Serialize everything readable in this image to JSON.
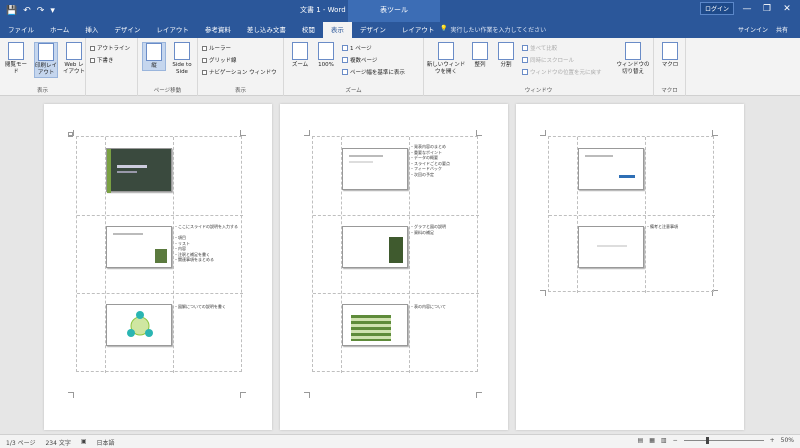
{
  "title_bar": {
    "qat": [
      "💾",
      "↶",
      "↷",
      "▾"
    ],
    "doc_title": "文書 1 - Word",
    "context_group": "表ツール",
    "ribbon_option": "ログイン",
    "controls": [
      "—",
      "❐",
      "✕"
    ]
  },
  "tabs": {
    "items": [
      "ファイル",
      "ホーム",
      "挿入",
      "デザイン",
      "レイアウト",
      "参考資料",
      "差し込み文書",
      "校閲",
      "表示",
      "デザイン",
      "レイアウト"
    ],
    "active_index": 8,
    "tellme": "実行したい作業を入力してください",
    "user_actions": [
      "サインイン",
      "共有"
    ]
  },
  "ribbon": {
    "views": {
      "read_mode": "閲覧モード",
      "print_layout": "印刷レイアウト",
      "web_layout": "Web レイアウト",
      "outline": "アウトライン",
      "draft": "下書き",
      "label": "表示"
    },
    "page_movement": {
      "vertical": "縦",
      "side_by_side": "Side to Side",
      "label": "ページ移動"
    },
    "show": {
      "ruler": "ルーラー",
      "gridlines": "グリッド線",
      "nav_pane": "ナビゲーション ウィンドウ",
      "label": "表示"
    },
    "zoom": {
      "zoom": "ズーム",
      "percent": "100%",
      "one_page": "1 ページ",
      "multiple_pages": "複数ページ",
      "page_width": "ページ幅を基準に表示",
      "label": "ズーム"
    },
    "window": {
      "new_window": "新しいウィンドウを開く",
      "arrange_all": "整列",
      "split": "分割",
      "side_by_side": "並べて比較",
      "sync_scroll": "同時にスクロール",
      "reset_position": "ウィンドウの位置を元に戻す",
      "switch_windows": "ウィンドウの切り替え",
      "label": "ウィンドウ"
    },
    "macros": {
      "macro": "マクロ",
      "label": "マクロ"
    }
  },
  "pages": [
    {
      "notes": [
        "",
        "・ここにスライドの説明を入力する\n\n・項目\n・リスト\n・内容\n・注釈と補足を書く\n・関連事項をまとめる",
        "・図解についての説明を書く"
      ]
    },
    {
      "notes": [
        "・発表内容のまとめ\n・重要なポイント\n・データの概要\n・スライドごとの要点\n・フィードバック\n・次回の予定",
        "・グラフと図の説明\n・資料の補足",
        "・表の内容について"
      ]
    },
    {
      "notes": [
        "",
        "・備考と注意事項"
      ]
    }
  ],
  "status": {
    "page": "1/3 ページ",
    "words": "234 文字",
    "lang": "日本語",
    "zoom": "50%"
  }
}
